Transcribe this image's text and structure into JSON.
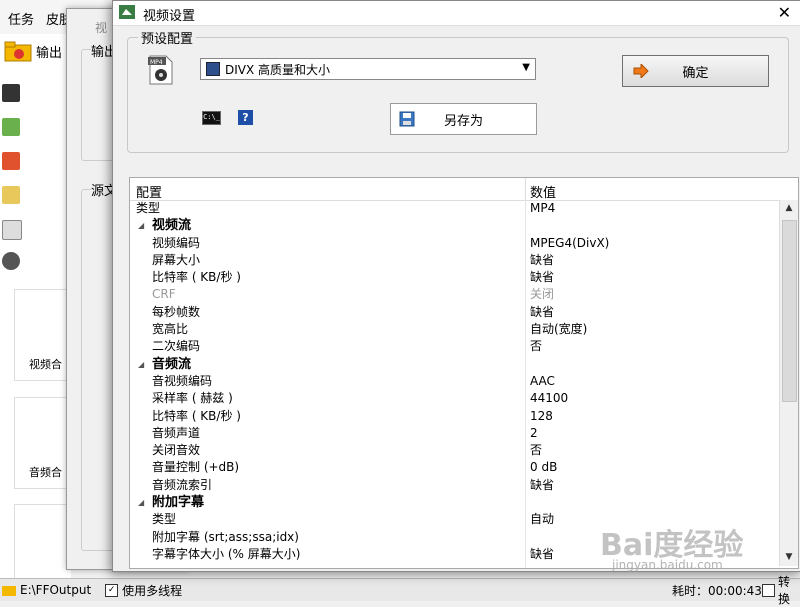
{
  "app": {
    "menu": [
      "任务",
      "皮肤"
    ],
    "output_button": "输出",
    "task_cards": [
      "视频合",
      "音频合"
    ],
    "status_path": "E:\\FFOutput",
    "status_multithread": "使用多线程",
    "status_time": "耗时：00:00:43",
    "status_right": "转换"
  },
  "mid_dialog": {
    "title": "视",
    "group1": "输出",
    "group2": "源文"
  },
  "dialog": {
    "title": "视频设置",
    "preset_group_label": "预设配置",
    "preset_value": "DIVX 高质量和大小",
    "ok_label": "确定",
    "saveas_label": "另存为",
    "cmd_icon_text": "C:\\_",
    "help_icon_text": "?",
    "grid_header_name": "配置",
    "grid_header_value": "数值",
    "rows": [
      {
        "name": "类型",
        "value": "MP4",
        "kind": "top"
      },
      {
        "name": "视频流",
        "value": "",
        "kind": "cat"
      },
      {
        "name": "视频编码",
        "value": "MPEG4(DivX)"
      },
      {
        "name": "屏幕大小",
        "value": "缺省"
      },
      {
        "name": "比特率 ( KB/秒 )",
        "value": "缺省"
      },
      {
        "name": "CRF",
        "value": "关闭",
        "kind": "disabled"
      },
      {
        "name": "每秒帧数",
        "value": "缺省"
      },
      {
        "name": "宽高比",
        "value": "自动(宽度)"
      },
      {
        "name": "二次编码",
        "value": "否"
      },
      {
        "name": "音频流",
        "value": "",
        "kind": "cat"
      },
      {
        "name": "音视频编码",
        "value": "AAC"
      },
      {
        "name": "采样率 ( 赫兹 )",
        "value": "44100"
      },
      {
        "name": "比特率 ( KB/秒 )",
        "value": "128"
      },
      {
        "name": "音频声道",
        "value": "2"
      },
      {
        "name": "关闭音效",
        "value": "否"
      },
      {
        "name": "音量控制 (+dB)",
        "value": "0 dB"
      },
      {
        "name": "音频流索引",
        "value": "缺省"
      },
      {
        "name": "附加字幕",
        "value": "",
        "kind": "cat"
      },
      {
        "name": "类型",
        "value": "自动"
      },
      {
        "name": "附加字幕 (srt;ass;ssa;idx)",
        "value": ""
      },
      {
        "name": "字幕字体大小 (% 屏幕大小)",
        "value": "缺省"
      }
    ],
    "watermark": "Bai度经验",
    "watermark_url": "jingyan.baidu.com"
  },
  "colors": {
    "accent_orange": "#f07a1a",
    "select_icon": "#2d4f8c",
    "help_blue": "#1d4fa8"
  }
}
